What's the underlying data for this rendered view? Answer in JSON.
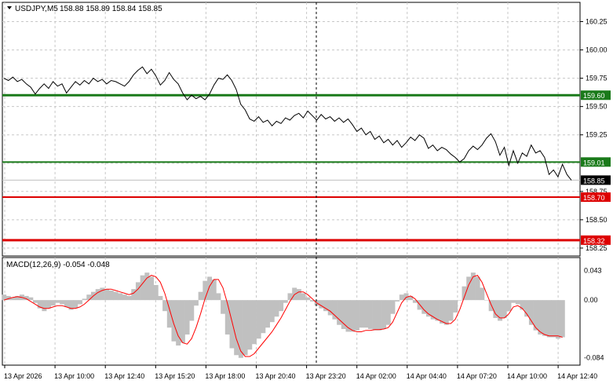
{
  "header": {
    "symbol": "USDJPY,M5",
    "ohlc": "158.88 158.89 158.84 158.85",
    "arrow_icon": "triangle-down-icon"
  },
  "macd": {
    "label": "MACD(12,26,9) -0.054 -0.048",
    "y_labels": [
      "0.043",
      "0.00",
      "-0.084"
    ],
    "colors": {
      "histogram": "#c0c0c0",
      "signal": "#ff0000"
    }
  },
  "price_axis": {
    "labels": [
      "160.25",
      "160.00",
      "159.75",
      "159.50",
      "159.25",
      "158.75",
      "158.50",
      "158.25"
    ]
  },
  "levels": [
    {
      "price": 159.6,
      "label": "159.60",
      "color": "#1a7a1a",
      "thick": true
    },
    {
      "price": 159.01,
      "label": "159.01",
      "color": "#1a7a1a",
      "thick": false
    },
    {
      "price": 158.7,
      "label": "158.70",
      "color": "#dd0000",
      "thick": false
    },
    {
      "price": 158.32,
      "label": "158.32",
      "color": "#dd0000",
      "thick": true
    }
  ],
  "current_price": {
    "label": "158.85",
    "price": 158.85
  },
  "time_axis": {
    "labels": [
      "13 Apr 2026",
      "13 Apr 10:00",
      "13 Apr 12:40",
      "13 Apr 15:20",
      "13 Apr 18:00",
      "13 Apr 20:40",
      "13 Apr 23:20",
      "14 Apr 02:00",
      "14 Apr 04:40",
      "14 Apr 07:20",
      "14 Apr 10:00",
      "14 Apr 12:40"
    ]
  },
  "chart_data": {
    "type": "line",
    "series_color": "#000000",
    "ylim": [
      158.18,
      160.42
    ],
    "y": [
      159.75,
      159.73,
      159.76,
      159.72,
      159.74,
      159.7,
      159.67,
      159.61,
      159.66,
      159.7,
      159.66,
      159.72,
      159.68,
      159.7,
      159.62,
      159.67,
      159.72,
      159.69,
      159.73,
      159.7,
      159.75,
      159.72,
      159.74,
      159.7,
      159.73,
      159.72,
      159.7,
      159.68,
      159.72,
      159.78,
      159.82,
      159.85,
      159.79,
      159.83,
      159.77,
      159.69,
      159.73,
      159.8,
      159.74,
      159.7,
      159.62,
      159.56,
      159.6,
      159.57,
      159.59,
      159.56,
      159.61,
      159.69,
      159.75,
      159.74,
      159.78,
      159.73,
      159.65,
      159.52,
      159.47,
      159.39,
      159.37,
      159.41,
      159.36,
      159.38,
      159.33,
      159.37,
      159.35,
      159.4,
      159.38,
      159.42,
      159.44,
      159.4,
      159.46,
      159.42,
      159.38,
      159.43,
      159.39,
      159.41,
      159.37,
      159.4,
      159.36,
      159.39,
      159.34,
      159.28,
      159.31,
      159.25,
      159.28,
      159.21,
      159.24,
      159.18,
      159.21,
      159.16,
      159.2,
      159.14,
      159.18,
      159.23,
      159.2,
      159.25,
      159.22,
      159.13,
      159.16,
      159.11,
      159.14,
      159.12,
      159.08,
      159.05,
      159.01,
      159.04,
      159.11,
      159.15,
      159.12,
      159.16,
      159.22,
      159.26,
      159.19,
      159.07,
      159.14,
      158.98,
      159.11,
      159.0,
      159.09,
      159.06,
      159.16,
      159.09,
      159.11,
      159.05,
      158.9,
      158.94,
      158.88,
      158.99,
      158.9,
      158.85
    ],
    "macd_hist": [
      0.008,
      0.006,
      0.004,
      0.006,
      0.008,
      0.006,
      0.004,
      -0.004,
      -0.012,
      -0.016,
      -0.012,
      -0.008,
      -0.004,
      -0.006,
      -0.01,
      -0.014,
      -0.012,
      -0.006,
      0.002,
      0.008,
      0.012,
      0.016,
      0.018,
      0.016,
      0.014,
      0.012,
      0.01,
      0.008,
      0.006,
      0.016,
      0.026,
      0.036,
      0.04,
      0.034,
      0.022,
      0.006,
      -0.016,
      -0.04,
      -0.06,
      -0.066,
      -0.062,
      -0.05,
      -0.03,
      -0.008,
      0.012,
      0.028,
      0.034,
      0.03,
      0.01,
      -0.02,
      -0.05,
      -0.07,
      -0.08,
      -0.084,
      -0.08,
      -0.072,
      -0.064,
      -0.056,
      -0.048,
      -0.04,
      -0.032,
      -0.024,
      -0.016,
      -0.004,
      0.01,
      0.018,
      0.016,
      0.01,
      0.004,
      -0.002,
      -0.008,
      -0.012,
      -0.016,
      -0.022,
      -0.028,
      -0.036,
      -0.042,
      -0.046,
      -0.046,
      -0.044,
      -0.04,
      -0.04,
      -0.042,
      -0.044,
      -0.044,
      -0.042,
      -0.036,
      -0.02,
      -0.002,
      0.008,
      0.01,
      0.006,
      -0.004,
      -0.014,
      -0.02,
      -0.024,
      -0.028,
      -0.03,
      -0.034,
      -0.036,
      -0.03,
      -0.018,
      0.0,
      0.02,
      0.034,
      0.04,
      0.034,
      0.018,
      0.0,
      -0.016,
      -0.026,
      -0.03,
      -0.026,
      -0.016,
      -0.004,
      -0.006,
      -0.014,
      -0.024,
      -0.036,
      -0.044,
      -0.05,
      -0.052,
      -0.054,
      -0.054,
      -0.056,
      -0.054
    ],
    "macd_signal": [
      0.0,
      0.002,
      0.004,
      0.005,
      0.004,
      0.002,
      -0.002,
      -0.006,
      -0.01,
      -0.012,
      -0.012,
      -0.01,
      -0.008,
      -0.008,
      -0.01,
      -0.012,
      -0.012,
      -0.01,
      -0.006,
      0.0,
      0.006,
      0.011,
      0.014,
      0.016,
      0.016,
      0.014,
      0.012,
      0.01,
      0.008,
      0.01,
      0.016,
      0.024,
      0.032,
      0.036,
      0.034,
      0.026,
      0.01,
      -0.012,
      -0.034,
      -0.052,
      -0.062,
      -0.064,
      -0.056,
      -0.04,
      -0.02,
      0.002,
      0.02,
      0.03,
      0.03,
      0.018,
      -0.004,
      -0.03,
      -0.056,
      -0.074,
      -0.082,
      -0.082,
      -0.078,
      -0.07,
      -0.062,
      -0.054,
      -0.046,
      -0.036,
      -0.026,
      -0.014,
      -0.002,
      0.008,
      0.012,
      0.012,
      0.008,
      0.002,
      -0.004,
      -0.008,
      -0.012,
      -0.016,
      -0.022,
      -0.028,
      -0.034,
      -0.04,
      -0.044,
      -0.046,
      -0.046,
      -0.044,
      -0.044,
      -0.043,
      -0.043,
      -0.042,
      -0.04,
      -0.032,
      -0.018,
      -0.004,
      0.004,
      0.006,
      0.002,
      -0.006,
      -0.014,
      -0.02,
      -0.024,
      -0.028,
      -0.031,
      -0.034,
      -0.034,
      -0.028,
      -0.014,
      0.004,
      0.022,
      0.034,
      0.036,
      0.026,
      0.01,
      -0.006,
      -0.02,
      -0.026,
      -0.026,
      -0.02,
      -0.01,
      -0.008,
      -0.012,
      -0.02,
      -0.03,
      -0.04,
      -0.046,
      -0.05,
      -0.052,
      -0.052,
      -0.052,
      -0.054
    ],
    "macd_ylim": [
      -0.09,
      0.055
    ]
  }
}
